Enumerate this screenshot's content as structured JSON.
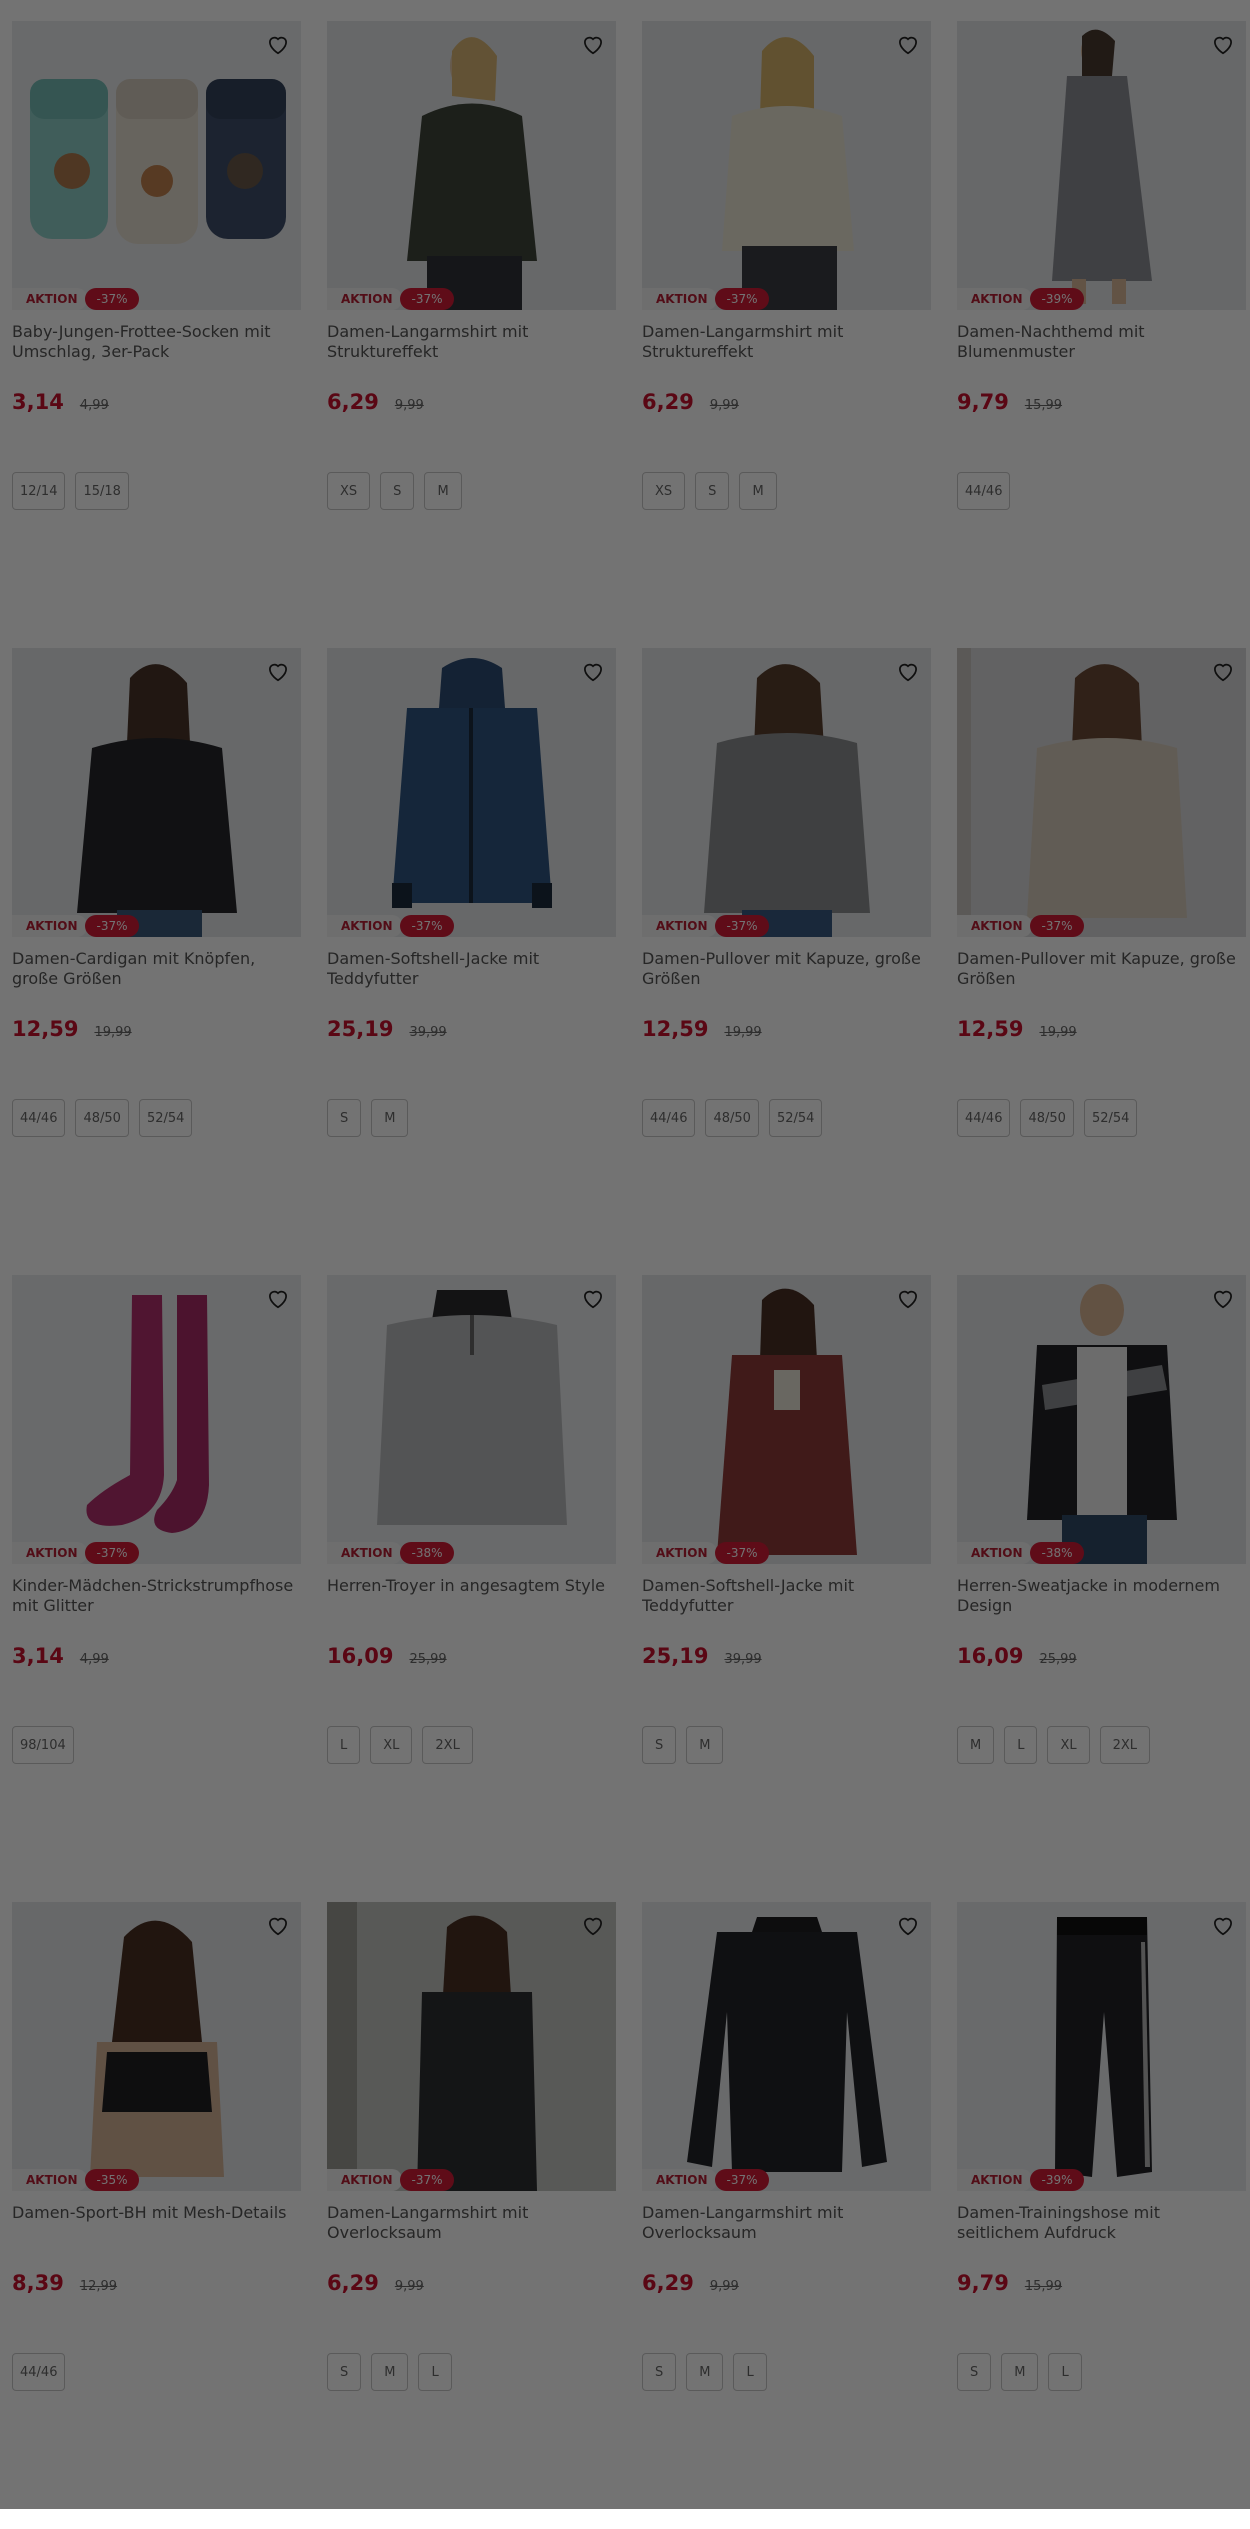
{
  "products": [
    {
      "title": "Baby-Jungen-Frottee-Socken mit Umschlag, 3er-Pack",
      "badge": "AKTION",
      "discount": "-37%",
      "price": "3,14",
      "old_price": "4,99",
      "sizes": [
        "12/14",
        "15/18"
      ],
      "image": "socks-3pack"
    },
    {
      "title": "Damen-Langarmshirt mit Struktureffekt",
      "badge": "AKTION",
      "discount": "-37%",
      "price": "6,29",
      "old_price": "9,99",
      "sizes": [
        "XS",
        "S",
        "M"
      ],
      "image": "woman-dark-longsleeve"
    },
    {
      "title": "Damen-Langarmshirt mit Struktureffekt",
      "badge": "AKTION",
      "discount": "-37%",
      "price": "6,29",
      "old_price": "9,99",
      "sizes": [
        "XS",
        "S",
        "M"
      ],
      "image": "woman-cream-longsleeve"
    },
    {
      "title": "Damen-Nachthemd mit Blumenmuster",
      "badge": "AKTION",
      "discount": "-39%",
      "price": "9,79",
      "old_price": "15,99",
      "sizes": [
        "44/46"
      ],
      "image": "woman-nightdress"
    },
    {
      "title": "Damen-Cardigan mit Knöpfen, große Größen",
      "badge": "AKTION",
      "discount": "-37%",
      "price": "12,59",
      "old_price": "19,99",
      "sizes": [
        "44/46",
        "48/50",
        "52/54"
      ],
      "image": "woman-black-cardigan"
    },
    {
      "title": "Damen-Softshell-Jacke mit Teddyfutter",
      "badge": "AKTION",
      "discount": "-37%",
      "price": "25,19",
      "old_price": "39,99",
      "sizes": [
        "S",
        "M"
      ],
      "image": "blue-softshell-jacket"
    },
    {
      "title": "Damen-Pullover mit Kapuze, große Größen",
      "badge": "AKTION",
      "discount": "-37%",
      "price": "12,59",
      "old_price": "19,99",
      "sizes": [
        "44/46",
        "48/50",
        "52/54"
      ],
      "image": "woman-grey-hoodie"
    },
    {
      "title": "Damen-Pullover mit Kapuze, große Größen",
      "badge": "AKTION",
      "discount": "-37%",
      "price": "12,59",
      "old_price": "19,99",
      "sizes": [
        "44/46",
        "48/50",
        "52/54"
      ],
      "image": "woman-beige-hoodie"
    },
    {
      "title": "Kinder-Mädchen-Strickstrumpfhose mit Glitter",
      "badge": "AKTION",
      "discount": "-37%",
      "price": "3,14",
      "old_price": "4,99",
      "sizes": [
        "98/104"
      ],
      "image": "pink-tights"
    },
    {
      "title": "Herren-Troyer in angesagtem Style",
      "badge": "AKTION",
      "discount": "-38%",
      "price": "16,09",
      "old_price": "25,99",
      "sizes": [
        "L",
        "XL",
        "2XL"
      ],
      "image": "grey-troyer"
    },
    {
      "title": "Damen-Softshell-Jacke mit Teddyfutter",
      "badge": "AKTION",
      "discount": "-37%",
      "price": "25,19",
      "old_price": "39,99",
      "sizes": [
        "S",
        "M"
      ],
      "image": "woman-red-jacket"
    },
    {
      "title": "Herren-Sweatjacke in modernem Design",
      "badge": "AKTION",
      "discount": "-38%",
      "price": "16,09",
      "old_price": "25,99",
      "sizes": [
        "M",
        "L",
        "XL",
        "2XL"
      ],
      "image": "man-sweatjacket"
    },
    {
      "title": "Damen-Sport-BH mit Mesh-Details",
      "badge": "AKTION",
      "discount": "-35%",
      "price": "8,39",
      "old_price": "12,99",
      "sizes": [
        "44/46"
      ],
      "image": "woman-sport-bra"
    },
    {
      "title": "Damen-Langarmshirt mit Overlocksaum",
      "badge": "AKTION",
      "discount": "-37%",
      "price": "6,29",
      "old_price": "9,99",
      "sizes": [
        "S",
        "M",
        "L"
      ],
      "image": "woman-black-longsleeve"
    },
    {
      "title": "Damen-Langarmshirt mit Overlocksaum",
      "badge": "AKTION",
      "discount": "-37%",
      "price": "6,29",
      "old_price": "9,99",
      "sizes": [
        "S",
        "M",
        "L"
      ],
      "image": "black-longsleeve-flat"
    },
    {
      "title": "Damen-Trainingshose mit seitlichem Aufdruck",
      "badge": "AKTION",
      "discount": "-39%",
      "price": "9,79",
      "old_price": "15,99",
      "sizes": [
        "S",
        "M",
        "L"
      ],
      "image": "black-training-pants"
    }
  ],
  "colors": {
    "price": "#c8102e",
    "discount_badge": "#d31b37",
    "overlay": "rgba(0,0,0,0.55)"
  },
  "icons": {
    "favorite": "heart-outline-icon"
  }
}
